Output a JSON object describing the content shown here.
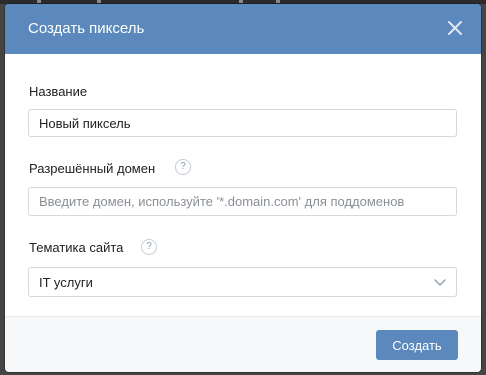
{
  "dialog": {
    "title": "Создать пиксель",
    "close_icon": "close-icon"
  },
  "form": {
    "name": {
      "label": "Название",
      "value": "Новый пиксель"
    },
    "domain": {
      "label": "Разрешённый домен",
      "help": "?",
      "placeholder": "Введите домен, используйте '*.domain.com' для поддоменов"
    },
    "category": {
      "label": "Тематика сайта",
      "help": "?",
      "selected": "IT услуги",
      "icon": "chevron-down-icon"
    }
  },
  "footer": {
    "create_label": "Создать"
  },
  "colors": {
    "accent": "#5b88bd",
    "border": "#d3d9de",
    "footer_bg": "#f7f8fa"
  }
}
